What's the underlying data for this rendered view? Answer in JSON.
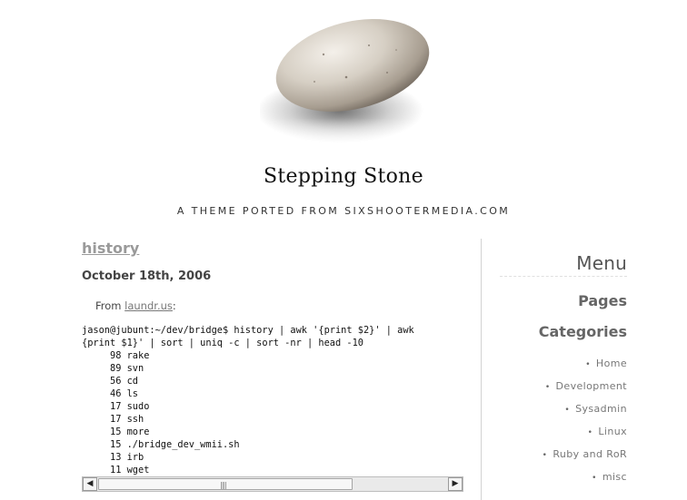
{
  "site": {
    "title": "Stepping Stone",
    "tagline": "A THEME PORTED FROM SIXSHOOTERMEDIA.COM"
  },
  "post": {
    "title": "history",
    "date": "October 18th, 2006",
    "intro_prefix": "From ",
    "intro_link": "laundr.us",
    "intro_suffix": ":",
    "code_lines": [
      "jason@jubunt:~/dev/bridge$ history | awk '{print $2}' | awk",
      "{print $1}' | sort | uniq -c | sort -nr | head -10",
      "     98 rake",
      "     89 svn",
      "     56 cd",
      "     46 ls",
      "     17 sudo",
      "     17 ssh",
      "     15 more",
      "     15 ./bridge_dev_wmii.sh",
      "     13 irb",
      "     11 wget"
    ]
  },
  "scrollbar": {
    "left_icon": "arrow-left-icon",
    "right_icon": "arrow-right-icon",
    "left_glyph": "◀",
    "right_glyph": "▶",
    "grip_glyph": "||||"
  },
  "sidebar": {
    "menu_heading": "Menu",
    "pages_heading": "Pages",
    "categories_heading": "Categories",
    "bullet": "•",
    "categories": [
      "Home",
      "Development",
      "Sysadmin",
      "Linux",
      "Ruby and RoR",
      "misc"
    ]
  }
}
